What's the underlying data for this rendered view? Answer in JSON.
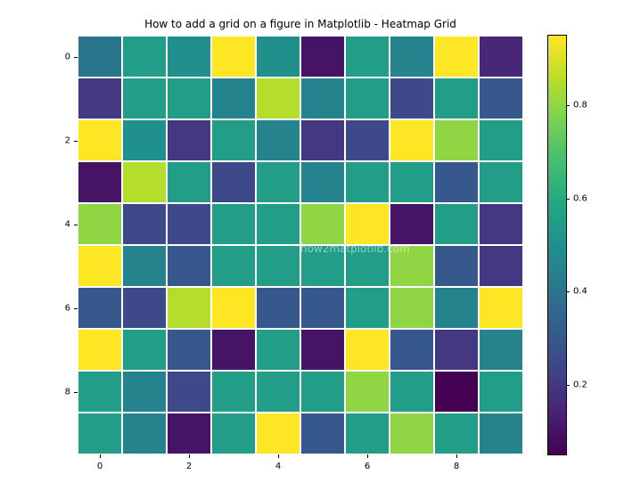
{
  "chart_data": {
    "type": "heatmap",
    "title": "How to add a grid on a figure in Matplotlib - Heatmap Grid",
    "xlabel": "",
    "ylabel": "",
    "x_ticks": [
      0,
      2,
      4,
      6,
      8
    ],
    "y_ticks": [
      0,
      2,
      4,
      6,
      8
    ],
    "colorbar_ticks": [
      0.2,
      0.4,
      0.6,
      0.8
    ],
    "rows": 10,
    "cols": 10,
    "colormap": "viridis",
    "grid_color": "white",
    "values": [
      [
        0.4,
        0.55,
        0.5,
        0.95,
        0.5,
        0.1,
        0.55,
        0.45,
        0.95,
        0.15
      ],
      [
        0.2,
        0.55,
        0.55,
        0.45,
        0.85,
        0.45,
        0.55,
        0.25,
        0.55,
        0.3
      ],
      [
        0.95,
        0.5,
        0.2,
        0.55,
        0.45,
        0.2,
        0.25,
        0.95,
        0.8,
        0.55
      ],
      [
        0.1,
        0.85,
        0.55,
        0.25,
        0.55,
        0.45,
        0.55,
        0.55,
        0.3,
        0.55
      ],
      [
        0.8,
        0.25,
        0.25,
        0.55,
        0.55,
        0.8,
        0.95,
        0.1,
        0.55,
        0.2
      ],
      [
        0.95,
        0.45,
        0.3,
        0.55,
        0.55,
        0.55,
        0.55,
        0.8,
        0.3,
        0.2
      ],
      [
        0.3,
        0.25,
        0.85,
        0.95,
        0.3,
        0.3,
        0.55,
        0.8,
        0.45,
        0.95
      ],
      [
        0.95,
        0.55,
        0.3,
        0.1,
        0.55,
        0.1,
        0.95,
        0.3,
        0.2,
        0.45
      ],
      [
        0.55,
        0.45,
        0.25,
        0.55,
        0.55,
        0.55,
        0.8,
        0.55,
        0.05,
        0.55
      ],
      [
        0.55,
        0.45,
        0.1,
        0.55,
        0.95,
        0.3,
        0.55,
        0.8,
        0.55,
        0.45
      ]
    ],
    "watermark": "how2matplotlib.com"
  }
}
